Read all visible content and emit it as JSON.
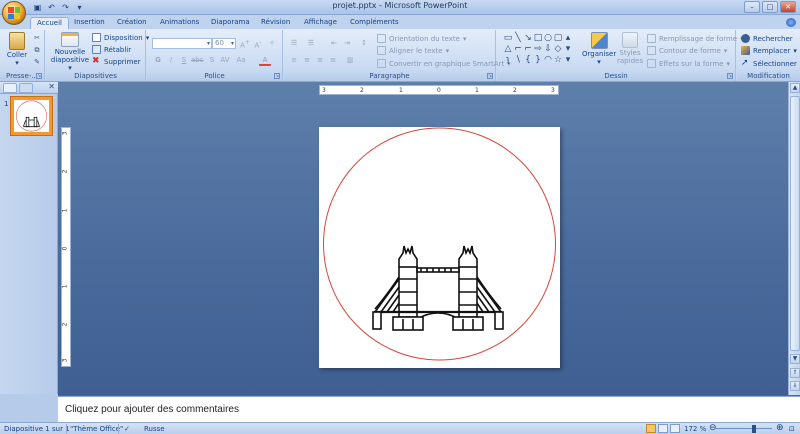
{
  "window": {
    "title": "projet.pptx - Microsoft PowerPoint"
  },
  "quick_access": {
    "save_icon": "save-icon",
    "undo_icon": "undo-icon",
    "redo_icon": "redo-icon"
  },
  "tabs": [
    {
      "label": "Accueil",
      "active": true
    },
    {
      "label": "Insertion"
    },
    {
      "label": "Création"
    },
    {
      "label": "Animations"
    },
    {
      "label": "Diaporama"
    },
    {
      "label": "Révision"
    },
    {
      "label": "Affichage"
    },
    {
      "label": "Compléments"
    }
  ],
  "ribbon": {
    "clipboard": {
      "label": "Presse-...",
      "paste": "Coller"
    },
    "slides": {
      "label": "Diapositives",
      "new_slide_line1": "Nouvelle",
      "new_slide_line2": "diapositive",
      "layout": "Disposition",
      "reset": "Rétablir",
      "delete": "Supprimer"
    },
    "font": {
      "label": "Police",
      "font_name": "",
      "font_size": "60"
    },
    "paragraph": {
      "label": "Paragraphe",
      "text_direction": "Orientation du texte",
      "align_text": "Aligner le texte",
      "smartart": "Convertir en graphique SmartArt"
    },
    "drawing": {
      "label": "Dessin",
      "arrange": "Organiser",
      "quick_styles_line1": "Styles",
      "quick_styles_line2": "rapides",
      "shape_fill": "Remplissage de forme",
      "shape_outline": "Contour de forme",
      "shape_effects": "Effets sur la forme"
    },
    "editing": {
      "label": "Modification",
      "find": "Rechercher",
      "replace": "Remplacer",
      "select": "Sélectionner"
    }
  },
  "rulers": {
    "horizontal": [
      "3",
      "2",
      "1",
      "0",
      "1",
      "2",
      "3"
    ],
    "vertical": [
      "3",
      "2",
      "1",
      "0",
      "1",
      "2",
      "3"
    ]
  },
  "thumbnails": [
    {
      "number": "1"
    }
  ],
  "notes": {
    "placeholder": "Cliquez pour ajouter des commentaires"
  },
  "status": {
    "slide_info": "Diapositive 1 sur 1",
    "theme": "\"Thème Office\"",
    "language": "Russe",
    "zoom": "172 %"
  },
  "colors": {
    "circle_stroke": "#d9453a",
    "thumbnail_border": "#f29a2c"
  }
}
